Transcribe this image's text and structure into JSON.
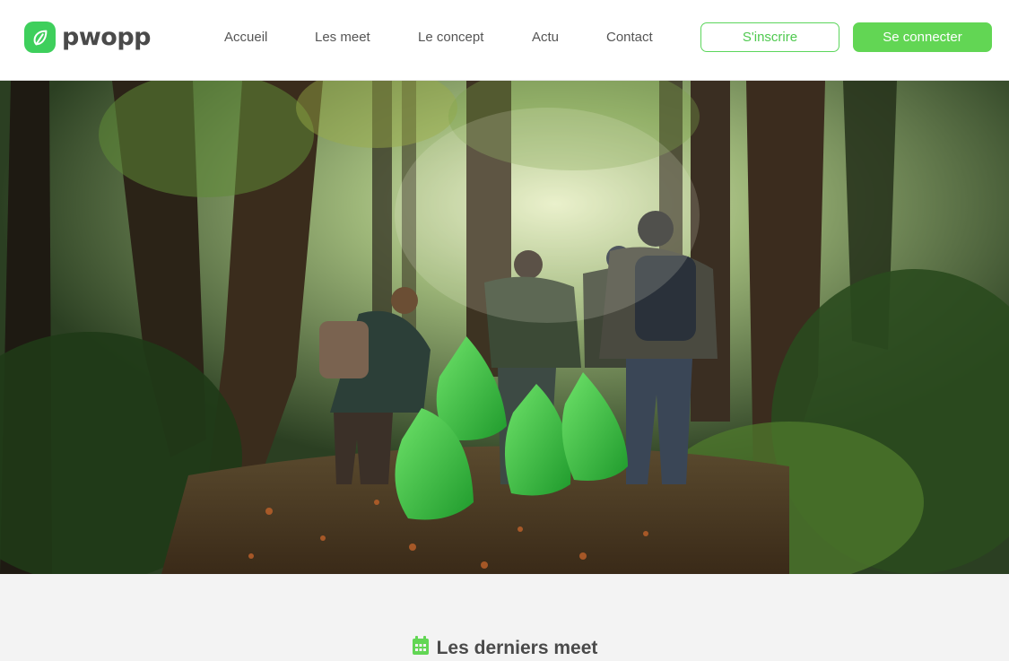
{
  "brand": {
    "name": "pwopp",
    "accent": "#5cd65c"
  },
  "nav": {
    "items": [
      {
        "label": "Accueil"
      },
      {
        "label": "Les meet"
      },
      {
        "label": "Le concept"
      },
      {
        "label": "Actu"
      },
      {
        "label": "Contact"
      }
    ]
  },
  "auth": {
    "signup_label": "S'inscrire",
    "login_label": "Se connecter"
  },
  "hero": {
    "image": "forest-cleanup-photo"
  },
  "section": {
    "title": "Les derniers meet",
    "icon": "calendar-icon"
  }
}
